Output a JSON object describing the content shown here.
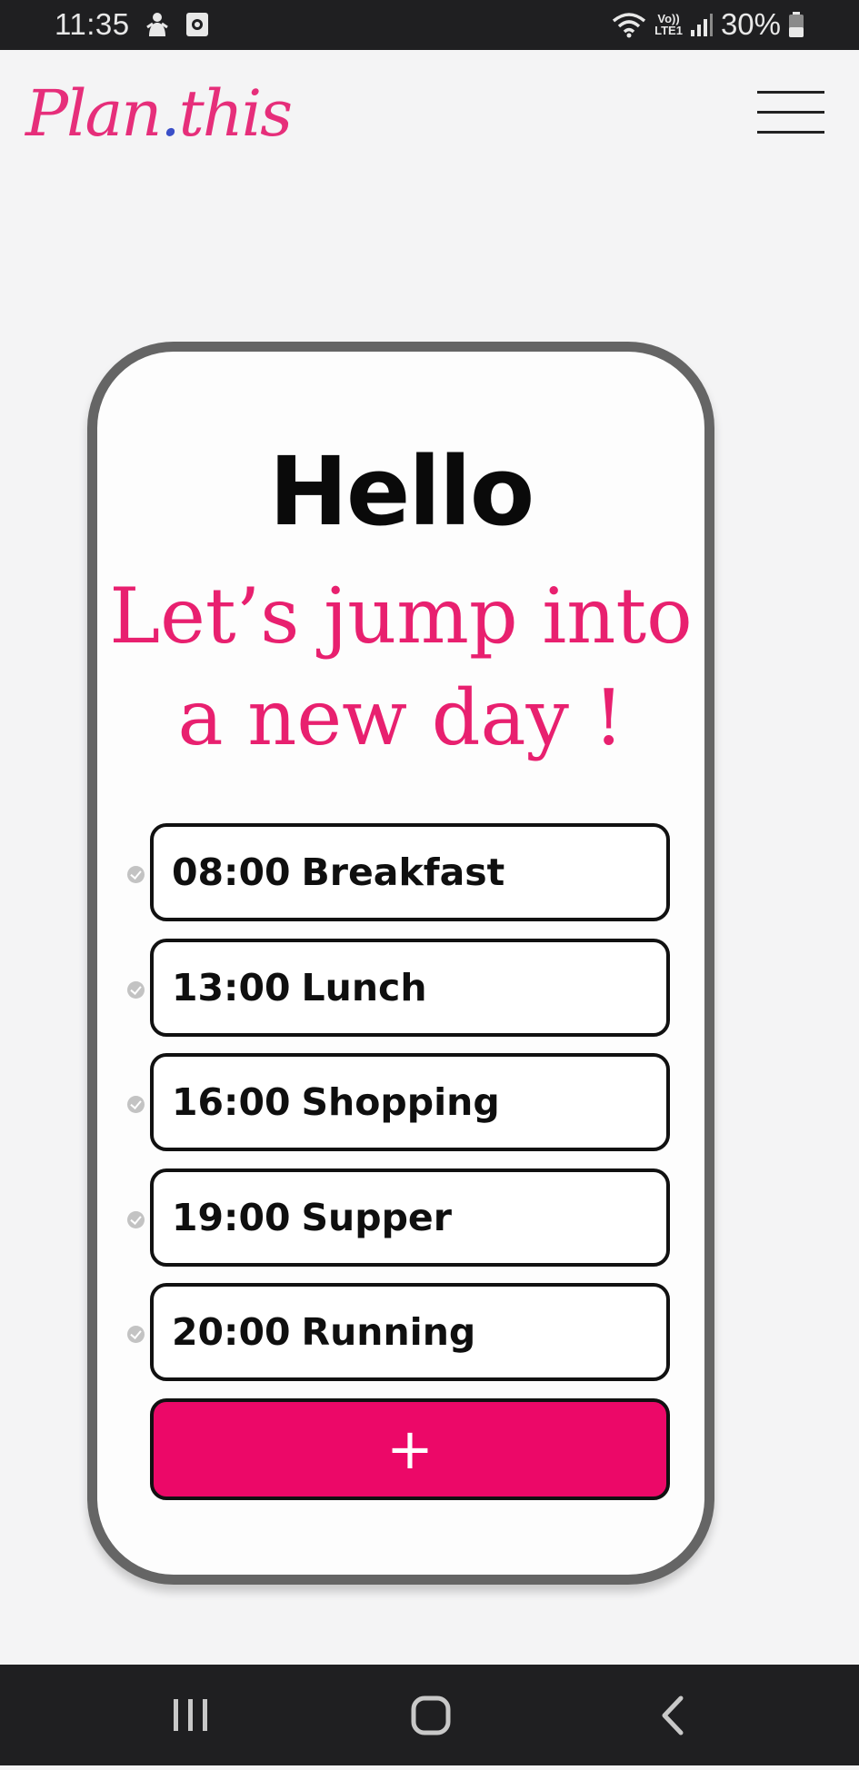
{
  "status_bar": {
    "time": "11:35",
    "lte_label_top": "Vo))",
    "lte_label_bottom": "LTE1",
    "battery_percent": "30%"
  },
  "header": {
    "logo_part1": "Plan",
    "logo_dot": ".",
    "logo_part2": "this",
    "menu_icon": "hamburger-menu-icon"
  },
  "card": {
    "greeting": "Hello",
    "tagline_line1": "Let’s jump into",
    "tagline_line2": "a new day !"
  },
  "schedule": {
    "items": [
      {
        "time": "08:00",
        "label": "Breakfast"
      },
      {
        "time": "13:00",
        "label": "Lunch"
      },
      {
        "time": "16:00",
        "label": "Shopping"
      },
      {
        "time": "19:00",
        "label": "Supper"
      },
      {
        "time": "20:00",
        "label": "Running"
      }
    ],
    "add_label": "+"
  },
  "nav_bar": {
    "recents_icon": "recent-apps-icon",
    "home_icon": "home-icon",
    "back_icon": "back-icon"
  },
  "colors": {
    "accent_pink": "#ec0868",
    "logo_pink": "#e62e7a",
    "tagline_pink": "#e8206f",
    "logo_dot_blue": "#3a4fc8",
    "card_border": "#656565",
    "system_bar": "#1f1f21"
  }
}
